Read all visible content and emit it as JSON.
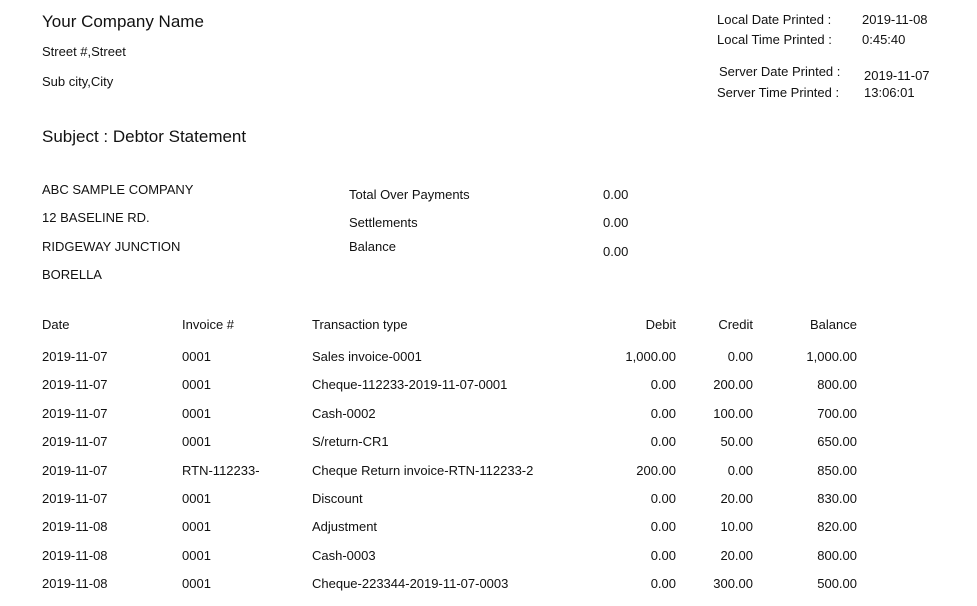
{
  "header": {
    "company_name": "Your Company Name",
    "street": "Street #,Street",
    "city": "Sub city,City"
  },
  "meta": {
    "local_date_label": "Local Date Printed  :",
    "local_date_value": "2019-11-08",
    "local_time_label": "Local Time Printed  :",
    "local_time_value": "0:45:40",
    "server_date_label": "Server Date Printed  :",
    "server_date_value": "2019-11-07",
    "server_time_label": "Server Time Printed  :",
    "server_time_value": "13:06:01"
  },
  "subject": "Subject : Debtor Statement",
  "customer": {
    "name": "ABC SAMPLE COMPANY",
    "address1": "12 BASELINE RD.",
    "address2": "RIDGEWAY JUNCTION",
    "address3": "BORELLA"
  },
  "summary": {
    "total_over_payments_label": "Total Over Payments",
    "total_over_payments_value": "0.00",
    "settlements_label": "Settlements",
    "settlements_value": "0.00",
    "balance_label": "Balance",
    "balance_value": "0.00"
  },
  "table": {
    "headers": {
      "date": "Date",
      "invoice": "Invoice #",
      "type": "Transaction type",
      "debit": "Debit",
      "credit": "Credit",
      "balance": "Balance"
    },
    "rows": [
      {
        "date": "2019-11-07",
        "invoice": "0001",
        "type": "Sales invoice-0001",
        "debit": "1,000.00",
        "credit": "0.00",
        "balance": "1,000.00"
      },
      {
        "date": "2019-11-07",
        "invoice": "0001",
        "type": "Cheque-112233-2019-11-07-0001",
        "debit": "0.00",
        "credit": "200.00",
        "balance": "800.00"
      },
      {
        "date": "2019-11-07",
        "invoice": "0001",
        "type": "Cash-0002",
        "debit": "0.00",
        "credit": "100.00",
        "balance": "700.00"
      },
      {
        "date": "2019-11-07",
        "invoice": "0001",
        "type": "S/return-CR1",
        "debit": "0.00",
        "credit": "50.00",
        "balance": "650.00"
      },
      {
        "date": "2019-11-07",
        "invoice": "RTN-112233-",
        "type": "Cheque Return invoice-RTN-112233-2",
        "debit": "200.00",
        "credit": "0.00",
        "balance": "850.00"
      },
      {
        "date": "2019-11-07",
        "invoice": "0001",
        "type": "Discount",
        "debit": "0.00",
        "credit": "20.00",
        "balance": "830.00"
      },
      {
        "date": "2019-11-08",
        "invoice": "0001",
        "type": "Adjustment",
        "debit": "0.00",
        "credit": "10.00",
        "balance": "820.00"
      },
      {
        "date": "2019-11-08",
        "invoice": "0001",
        "type": "Cash-0003",
        "debit": "0.00",
        "credit": "20.00",
        "balance": "800.00"
      },
      {
        "date": "2019-11-08",
        "invoice": "0001",
        "type": "Cheque-223344-2019-11-07-0003",
        "debit": "0.00",
        "credit": "300.00",
        "balance": "500.00"
      }
    ]
  }
}
